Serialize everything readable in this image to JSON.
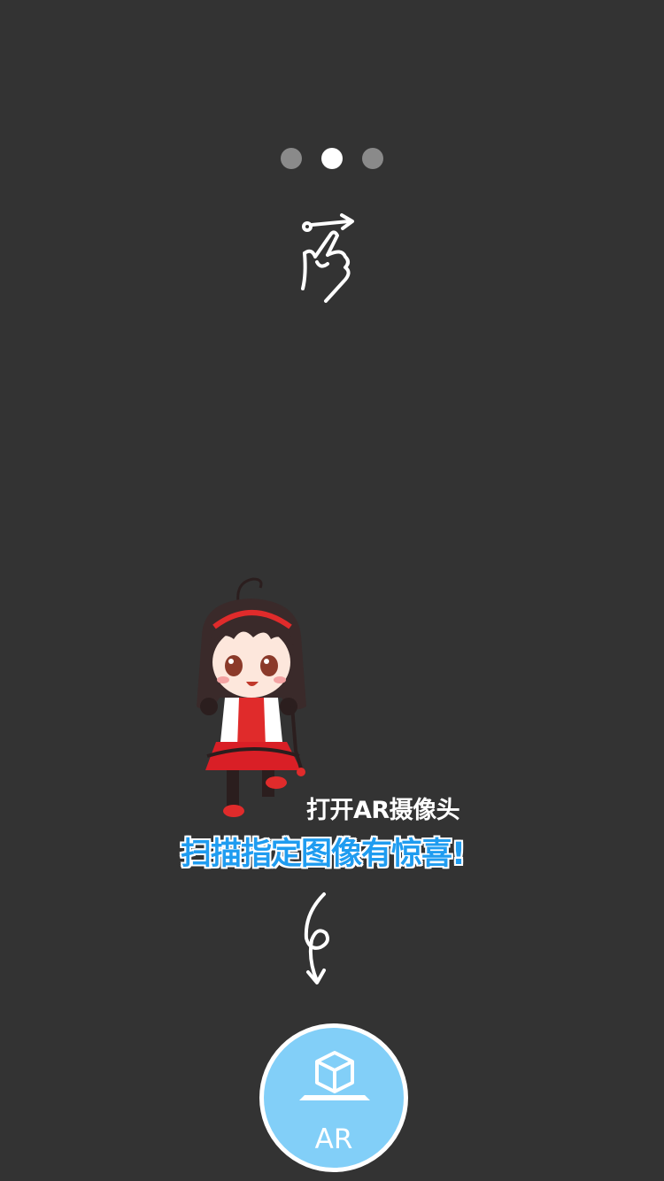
{
  "pager": {
    "total": 3,
    "active_index": 1
  },
  "gesture_hint": {
    "icon": "swipe-gesture-icon"
  },
  "mascot": {
    "icon": "chibi-girl-illustration"
  },
  "prompt": {
    "line1": "打开AR摄像头",
    "line2": "扫描指定图像有惊喜!",
    "line2_color": "#1f9cf0"
  },
  "scroll_hint": {
    "icon": "curly-arrow-down-icon"
  },
  "ar_button": {
    "label": "AR",
    "icon": "ar-cube-icon",
    "color": "#82cff8"
  },
  "colors": {
    "background": "#333333",
    "dot_inactive": "#8a8a8a",
    "dot_active": "#ffffff"
  }
}
